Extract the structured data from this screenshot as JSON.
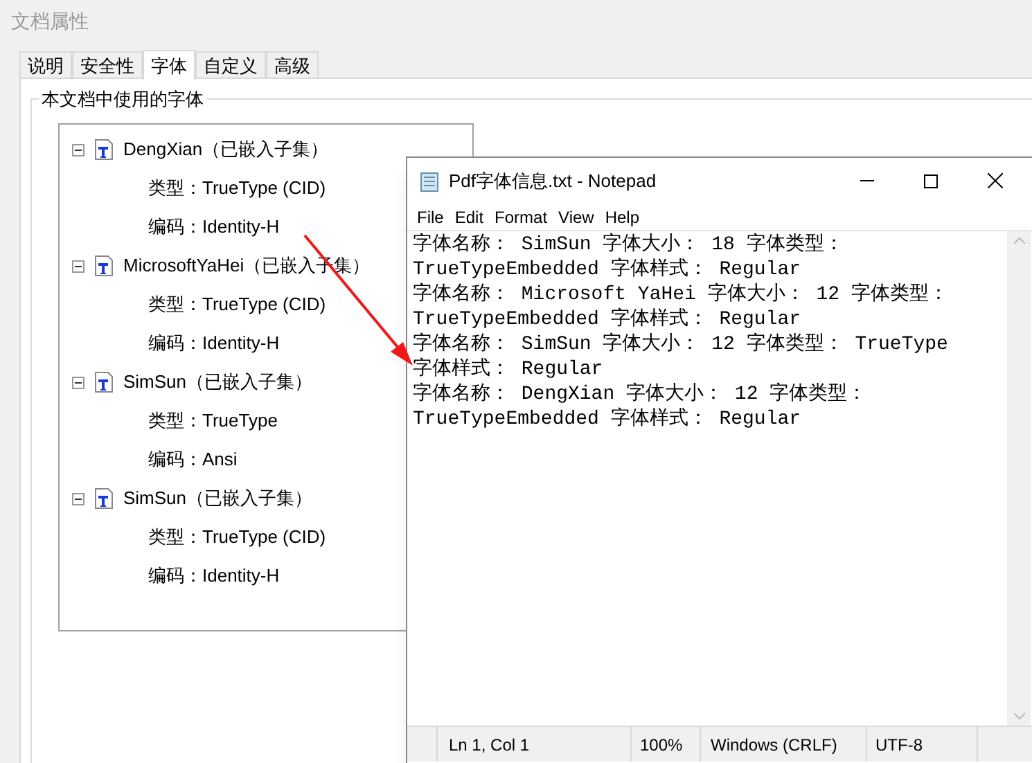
{
  "window": {
    "title": "文档属性"
  },
  "tabs": [
    {
      "label": "说明",
      "selected": false
    },
    {
      "label": "安全性",
      "selected": false
    },
    {
      "label": "字体",
      "selected": true
    },
    {
      "label": "自定义",
      "selected": false
    },
    {
      "label": "高级",
      "selected": false
    }
  ],
  "group": {
    "title": "本文档中使用的字体"
  },
  "fonts": [
    {
      "name": "DengXian（已嵌入子集）",
      "expanded": true,
      "children": [
        {
          "label": "类型：TrueType (CID)"
        },
        {
          "label": "编码：Identity-H"
        }
      ]
    },
    {
      "name": "MicrosoftYaHei（已嵌入子集）",
      "expanded": true,
      "children": [
        {
          "label": "类型：TrueType (CID)"
        },
        {
          "label": "编码：Identity-H"
        }
      ]
    },
    {
      "name": "SimSun（已嵌入子集）",
      "expanded": true,
      "children": [
        {
          "label": "类型：TrueType"
        },
        {
          "label": "编码：Ansi"
        }
      ]
    },
    {
      "name": "SimSun（已嵌入子集）",
      "expanded": true,
      "children": [
        {
          "label": "类型：TrueType (CID)"
        },
        {
          "label": "编码：Identity-H"
        }
      ]
    }
  ],
  "notepad": {
    "title": "Pdf字体信息.txt - Notepad",
    "menu": [
      "File",
      "Edit",
      "Format",
      "View",
      "Help"
    ],
    "lines": [
      "字体名称： SimSun 字体大小： 18 字体类型：",
      "TrueTypeEmbedded 字体样式： Regular",
      "字体名称： Microsoft YaHei 字体大小： 12 字体类型：",
      "TrueTypeEmbedded 字体样式： Regular",
      "字体名称： SimSun 字体大小： 12 字体类型： TrueType",
      "字体样式： Regular",
      "字体名称： DengXian 字体大小： 12 字体类型：",
      "TrueTypeEmbedded 字体样式： Regular"
    ],
    "status_bar": [
      "Ln 1, Col 1",
      "100%",
      "Windows (CRLF)",
      "UTF-8"
    ]
  }
}
